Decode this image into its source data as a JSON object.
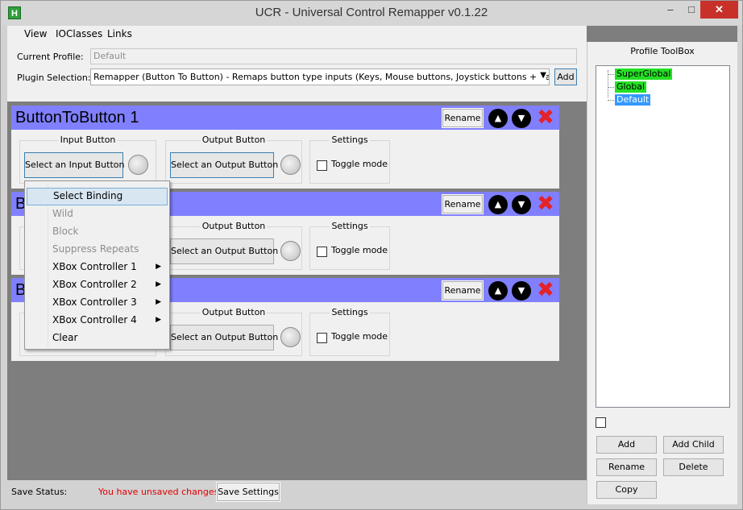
{
  "window": {
    "title": "UCR - Universal Control Remapper v0.1.22",
    "app_icon_letter": "H",
    "min_glyph": "–",
    "max_glyph": "□",
    "close_glyph": "✕"
  },
  "menubar": {
    "items": [
      "View",
      "IOClasses",
      "Links"
    ]
  },
  "header": {
    "current_profile_label": "Current Profile:",
    "current_profile_value": "Default",
    "plugin_selection_label": "Plugin Selection:",
    "plugin_selection_value": "Remapper (Button To Button)     - Remaps button type inputs (Keys, Mouse buttons, Joystick buttons + hat directions",
    "add_label": "Add"
  },
  "plugins": [
    {
      "title": "ButtonToButton 1",
      "rename_label": "Rename",
      "input_group_title": "Input Button",
      "input_button_label": "Select an Input Button",
      "output_group_title": "Output Button",
      "output_button_label": "Select an Output Button",
      "settings_group_title": "Settings",
      "toggle_label": "Toggle mode"
    },
    {
      "title": "B",
      "rename_label": "Rename",
      "output_group_title": "Output Button",
      "output_button_label": "Select an Output Button",
      "settings_group_title": "Settings",
      "toggle_label": "Toggle mode"
    },
    {
      "title": "B",
      "rename_label": "Rename",
      "output_group_title": "Output Button",
      "output_button_label": "Select an Output Button",
      "settings_group_title": "Settings",
      "toggle_label": "Toggle mode"
    }
  ],
  "context_menu": {
    "items": [
      {
        "label": "Select Binding",
        "state": "highlighted"
      },
      {
        "label": "Wild",
        "state": "disabled"
      },
      {
        "label": "Block",
        "state": "disabled"
      },
      {
        "label": "Suppress Repeats",
        "state": "disabled"
      },
      {
        "label": "XBox Controller 1",
        "submenu": true
      },
      {
        "label": "XBox Controller 2",
        "submenu": true
      },
      {
        "label": "XBox Controller 3",
        "submenu": true
      },
      {
        "label": "XBox Controller 4",
        "submenu": true
      },
      {
        "label": "Clear"
      }
    ]
  },
  "status": {
    "label": "Save Status:",
    "message": "You have unsaved changes",
    "message_color": "#e00000",
    "save_label": "Save Settings"
  },
  "toolbox": {
    "title": "Profile ToolBox",
    "tree": [
      "SuperGlobal",
      "Global",
      "Default"
    ],
    "buttons": {
      "add": "Add",
      "add_child": "Add Child",
      "rename": "Rename",
      "delete": "Delete",
      "copy": "Copy"
    }
  },
  "colors": {
    "plugin_header": "#8080ff",
    "node_green": "#24e024",
    "node_selected": "#3399ff",
    "delete_red": "#e3232a"
  },
  "icons": {
    "up": "chevron-up-icon",
    "down": "chevron-down-icon",
    "delete": "delete-x-icon"
  }
}
